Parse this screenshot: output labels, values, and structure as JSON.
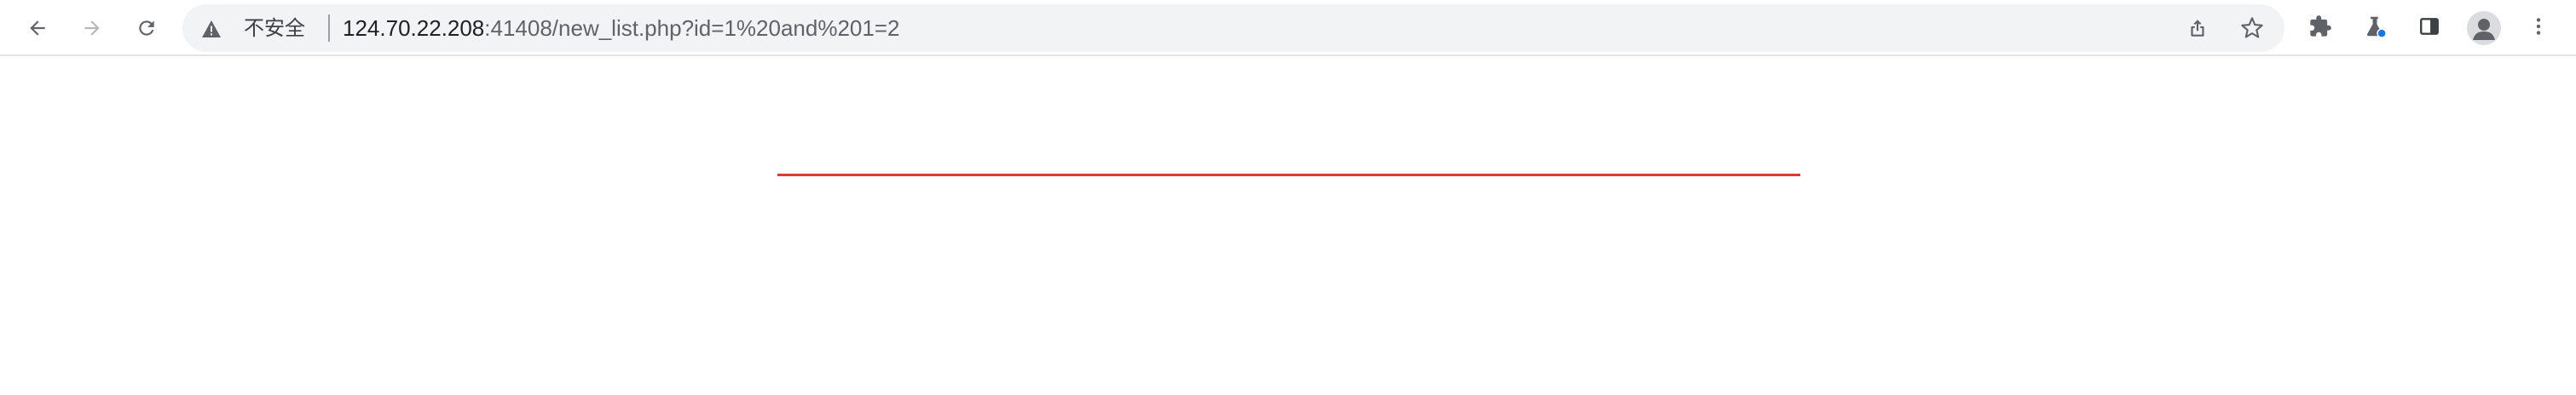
{
  "browser": {
    "address_bar": {
      "security_label": "不安全",
      "url_host": "124.70.22.208",
      "url_path": ":41408/new_list.php?id=1%20and%201=2"
    },
    "icons": {
      "back": "back-arrow-icon",
      "forward": "forward-arrow-icon",
      "reload": "reload-icon",
      "warning": "warning-triangle-icon",
      "share": "share-icon",
      "bookmark": "bookmark-star-icon",
      "extensions": "puzzle-icon",
      "labs": "labs-flask-icon",
      "side_panel": "side-panel-icon",
      "profile": "profile-avatar-icon",
      "menu": "more-vertical-icon"
    },
    "colors": {
      "accent_rule": "#e03b2e",
      "omnibox_bg": "#f1f3f4",
      "icon": "#5f6368",
      "labs_dot": "#1a73e8"
    }
  }
}
